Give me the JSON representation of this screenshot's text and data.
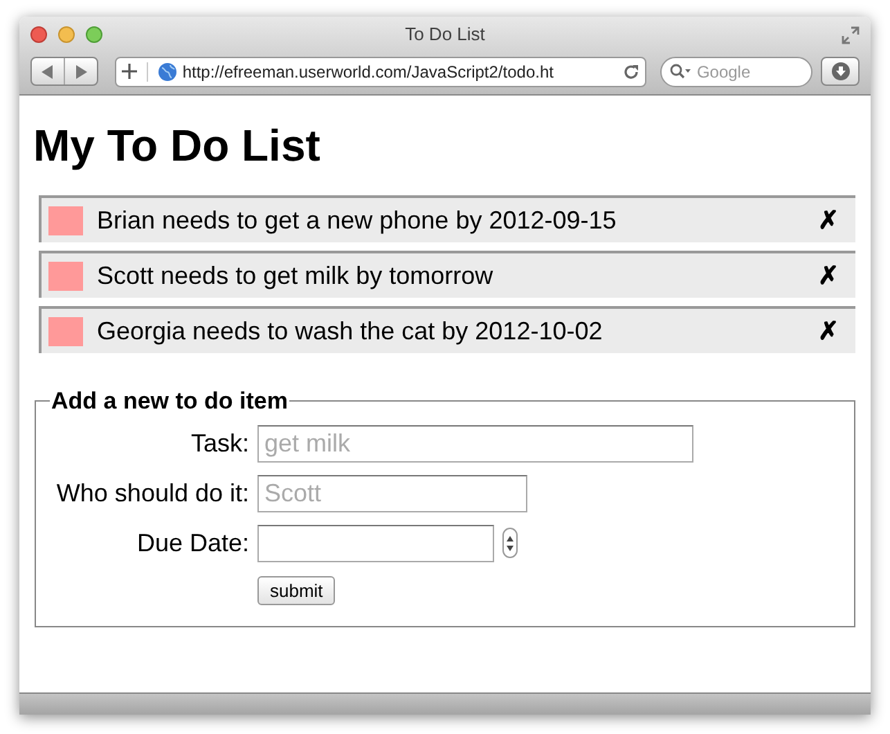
{
  "window": {
    "title": "To Do List"
  },
  "toolbar": {
    "url": "http://efreeman.userworld.com/JavaScript2/todo.ht",
    "search": {
      "placeholder": "Google"
    }
  },
  "page": {
    "heading": "My To Do List",
    "items": [
      {
        "text": "Brian needs to get a new phone by 2012-09-15",
        "delete": "✗"
      },
      {
        "text": "Scott needs to get milk by tomorrow",
        "delete": "✗"
      },
      {
        "text": "Georgia needs to wash the cat by 2012-10-02",
        "delete": "✗"
      }
    ],
    "form": {
      "legend": "Add a new to do item",
      "fields": [
        {
          "kind": "text",
          "label": "Task:",
          "placeholder": "get milk"
        },
        {
          "kind": "text",
          "label": "Who should do it:",
          "placeholder": "Scott"
        },
        {
          "kind": "date",
          "label": "Due Date:"
        }
      ],
      "submit": "submit"
    }
  }
}
